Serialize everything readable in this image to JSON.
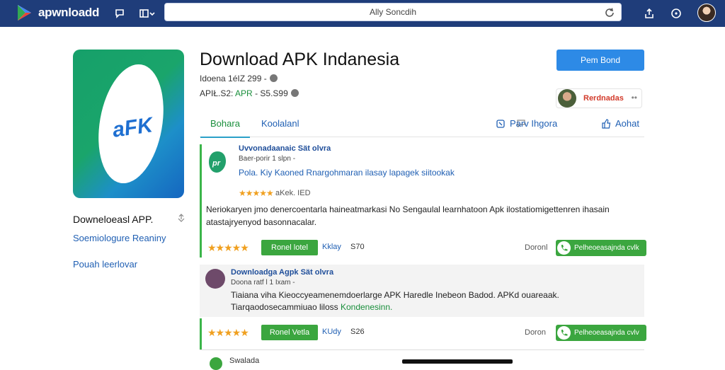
{
  "topbar": {
    "brand": "apwnloadd",
    "search_text": "Ally Soncdih",
    "colors": {
      "bar": "#1f3d7a"
    },
    "icons": [
      "play-logo-icon",
      "chat-icon",
      "layout-toggle-icon",
      "reload-icon",
      "share-icon",
      "info-icon",
      "profile-avatar"
    ]
  },
  "app": {
    "icon_text": "aFK",
    "title": "Download APK Indanesia",
    "meta1": "Idoena 1éIZ 299 -",
    "meta2_prefix": "APIŁ.S2:",
    "meta2_green": "APR",
    "meta2_suffix": "- S5.S99",
    "primary_button": "Pem Bond",
    "user_name": "Rerdnadas",
    "user_dots": "••"
  },
  "left": {
    "title": "Downeloeasl APP.",
    "link1": "Soemiologure  Reaniny",
    "link2": "Pouah leerlovar"
  },
  "tabs": {
    "tab1": "Bohara",
    "tab2": "Koolalanl",
    "right1": "Parv Ihgora",
    "right2": "Aohat"
  },
  "card1": {
    "title": "Uvvonadaanaic Sät olvra",
    "sub": "Baer-porir 1 slpn -",
    "link": "Pola. Kiy Kaoned Rnargohmaran ilasay lapagek siitookak",
    "stars": "★★★★★",
    "rating": "aKek. IED",
    "desc": "Neriokaryen jmo denercoentarla haineatmarkasi No Sengaulal learnhatoon Apk ilostatiomigettenren ihasain atastajryenyod basonnacalar."
  },
  "row1": {
    "stars": "★★★★★",
    "button": "Ronel lotel",
    "link": "Kklay",
    "count": "S70",
    "label": "Doronl",
    "green": "Pelheoeasajnda cvlk"
  },
  "card2": {
    "title": "Downloadga Agpk Sät olvra",
    "sub": "Doona ratf l 1 Ixam -",
    "text_line1": "Tiaiana viha Kieoccyeamenemdoerlarge APK Haredle Inebeon Badod. APKd ouareaak.",
    "text_line2_a": "Tiarqaodosecammiuao liloss",
    "text_line2_b": "Kondenesinn."
  },
  "row2": {
    "stars": "★★★★★",
    "button": "Ronel Vetla",
    "link": "KUdy",
    "count": "S26",
    "label": "Doron",
    "green": "Pelheoeasajnda cvlv"
  },
  "peek": {
    "text": "Swalada"
  }
}
